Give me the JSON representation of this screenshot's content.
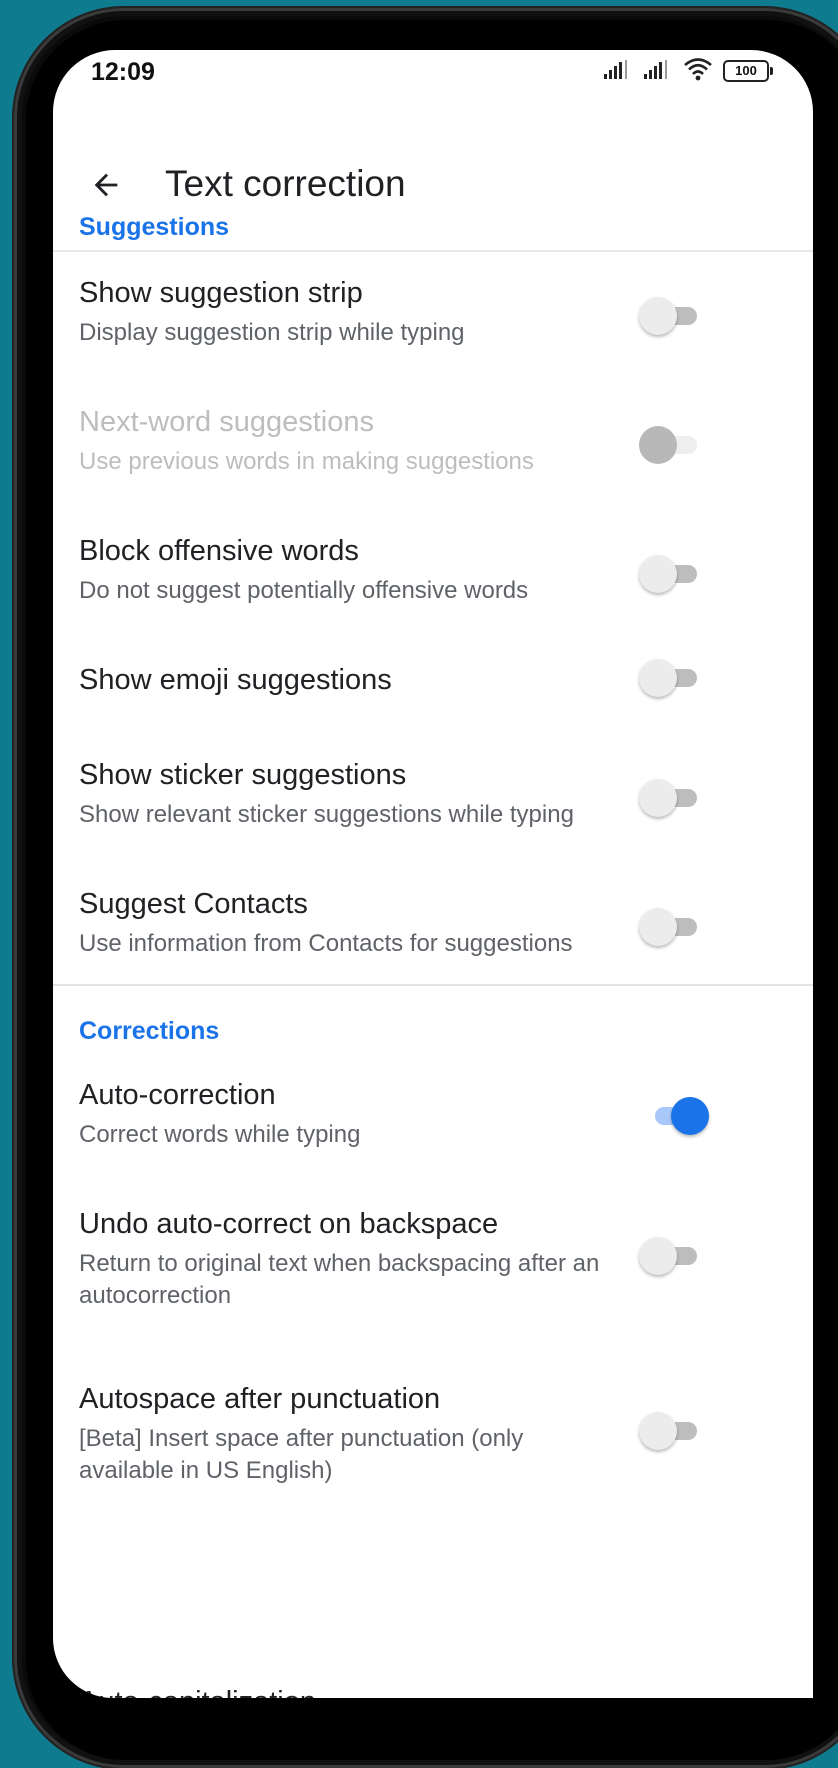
{
  "status_bar": {
    "time": "12:09",
    "battery": "100",
    "icons": [
      "signal-icon",
      "signal-icon",
      "wifi-icon",
      "battery-icon"
    ]
  },
  "app_bar": {
    "back_icon": "arrow-back-icon",
    "title": "Text correction"
  },
  "sections": {
    "suggestions": {
      "header": "Suggestions",
      "items": [
        {
          "title": "Show suggestion strip",
          "summary": "Display suggestion strip while typing",
          "enabled": false,
          "disabled": false
        },
        {
          "title": "Next-word suggestions",
          "summary": "Use previous words in making suggestions",
          "enabled": false,
          "disabled": true
        },
        {
          "title": "Block offensive words",
          "summary": "Do not suggest potentially offensive words",
          "enabled": false,
          "disabled": false
        },
        {
          "title": "Show emoji suggestions",
          "summary": "",
          "enabled": false,
          "disabled": false
        },
        {
          "title": "Show sticker suggestions",
          "summary": "Show relevant sticker suggestions while typing",
          "enabled": false,
          "disabled": false
        },
        {
          "title": "Suggest Contacts",
          "summary": "Use information from Contacts for suggestions",
          "enabled": false,
          "disabled": false
        }
      ]
    },
    "corrections": {
      "header": "Corrections",
      "items": [
        {
          "title": "Auto-correction",
          "summary": "Correct words while typing",
          "enabled": true,
          "disabled": false
        },
        {
          "title": "Undo auto-correct on backspace",
          "summary": "Return to original text when backspacing after an autocorrection",
          "enabled": false,
          "disabled": false
        },
        {
          "title": "Autospace after punctuation",
          "summary": "[Beta] Insert space after punctuation (only available in US English)",
          "enabled": false,
          "disabled": false
        }
      ],
      "next_item_partial": "Auto-capitalization"
    }
  },
  "colors": {
    "accent": "#1a73e8",
    "background": "#0f7b8f",
    "switch_off_track": "#bdbdbd",
    "switch_on_track": "#a9c8fa"
  }
}
